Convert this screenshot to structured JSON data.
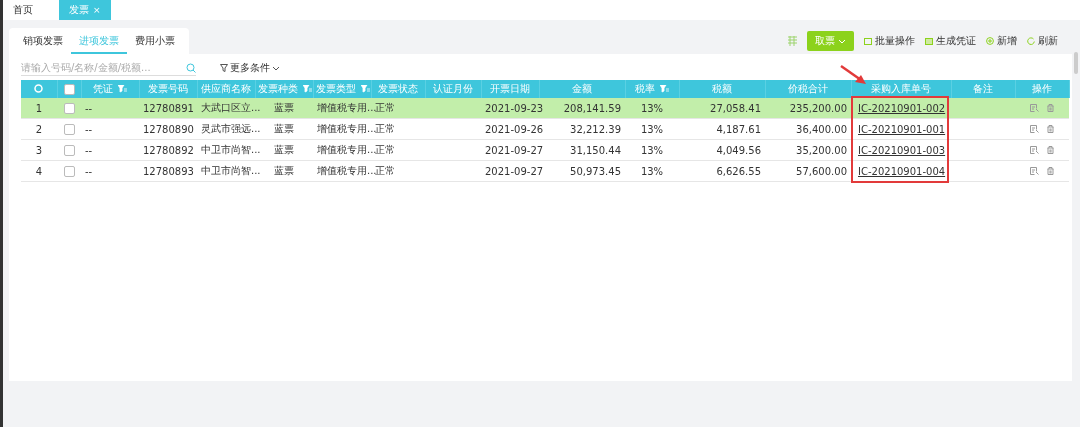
{
  "top_tabs": [
    {
      "label": "首页",
      "selected": false
    },
    {
      "label": "发票",
      "close": "×",
      "selected": true
    }
  ],
  "sub_tabs": [
    {
      "label": "销项发票",
      "selected": false
    },
    {
      "label": "进项发票",
      "selected": true
    },
    {
      "label": "费用小票",
      "selected": false
    }
  ],
  "toolbar": {
    "primary": "取票",
    "actions": [
      {
        "kind": "batch",
        "label": "批量操作"
      },
      {
        "kind": "voucher",
        "label": "生成凭证"
      },
      {
        "kind": "add",
        "label": "新增"
      },
      {
        "kind": "refresh",
        "label": "刷新"
      }
    ]
  },
  "search": {
    "placeholder": "请输入号码/名称/金额/税额..."
  },
  "more_filter": "更多条件",
  "table": {
    "select_all_checked": false,
    "columns": [
      {
        "kind": "settings"
      },
      {
        "kind": "check"
      },
      {
        "label": "凭证",
        "filter": true
      },
      {
        "label": "发票号码"
      },
      {
        "label": "供应商名称"
      },
      {
        "label": "发票种类",
        "filter": true
      },
      {
        "label": "发票类型",
        "filter": true
      },
      {
        "label": "发票状态"
      },
      {
        "label": "认证月份"
      },
      {
        "label": "开票日期"
      },
      {
        "label": "金额"
      },
      {
        "label": "税率",
        "filter": true
      },
      {
        "label": "税额"
      },
      {
        "label": "价税合计"
      },
      {
        "label": "采购入库单号"
      },
      {
        "label": "备注"
      },
      {
        "label": "操作",
        "kind": "ops"
      }
    ],
    "rows": [
      {
        "selected": true,
        "checked": false,
        "cells": [
          "1",
          "",
          "--",
          "12780891",
          "大武口区立...",
          "蓝票",
          "增值税专用...",
          "正常",
          "",
          "2021-09-23",
          "208,141.59",
          "13%",
          "27,058.41",
          "235,200.00",
          "IC-20210901-002",
          "",
          ""
        ]
      },
      {
        "selected": false,
        "checked": false,
        "cells": [
          "2",
          "",
          "--",
          "12780890",
          "灵武市强远...",
          "蓝票",
          "增值税专用...",
          "正常",
          "",
          "2021-09-26",
          "32,212.39",
          "13%",
          "4,187.61",
          "36,400.00",
          "IC-20210901-001",
          "",
          ""
        ]
      },
      {
        "selected": false,
        "checked": false,
        "cells": [
          "3",
          "",
          "--",
          "12780892",
          "中卫市尚智...",
          "蓝票",
          "增值税专用...",
          "正常",
          "",
          "2021-09-27",
          "31,150.44",
          "13%",
          "4,049.56",
          "35,200.00",
          "IC-20210901-003",
          "",
          ""
        ]
      },
      {
        "selected": false,
        "checked": false,
        "cells": [
          "4",
          "",
          "--",
          "12780893",
          "中卫市尚智...",
          "蓝票",
          "增值税专用...",
          "正常",
          "",
          "2021-09-27",
          "50,973.45",
          "13%",
          "6,626.55",
          "57,600.00",
          "IC-20210901-004",
          "",
          ""
        ]
      }
    ]
  }
}
